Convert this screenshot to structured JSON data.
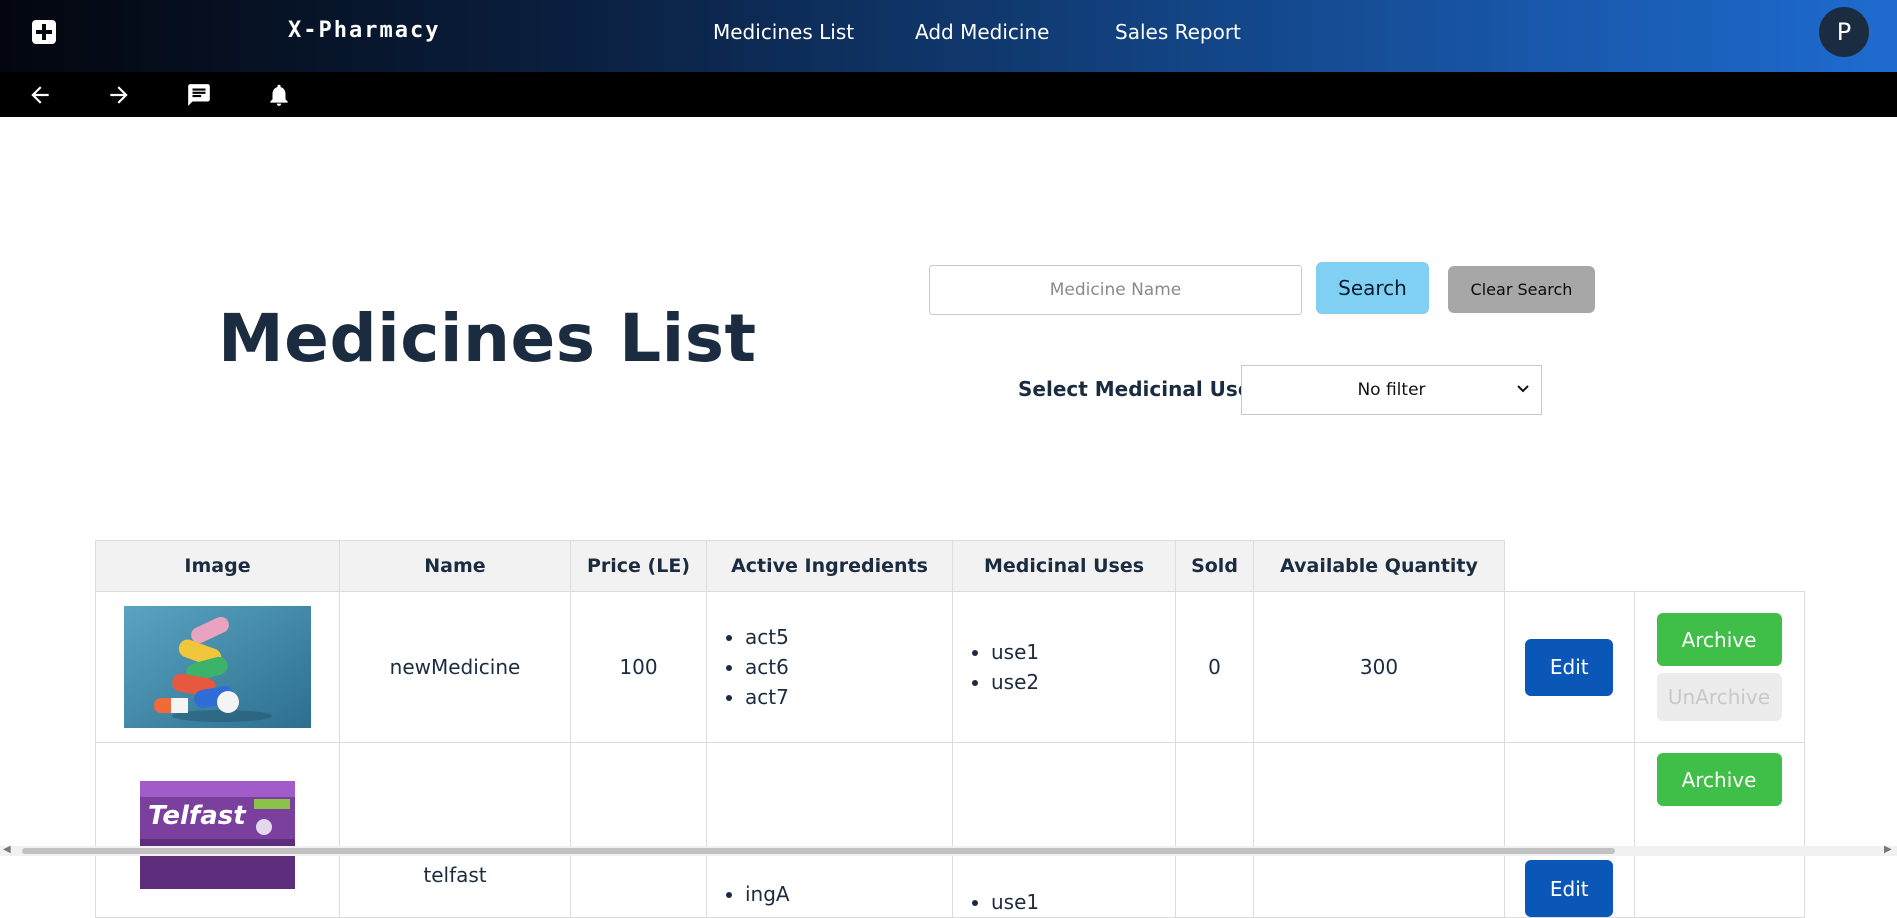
{
  "header": {
    "brand": "X-Pharmacy",
    "nav": [
      {
        "label": "Medicines List"
      },
      {
        "label": "Add Medicine"
      },
      {
        "label": "Sales Report"
      }
    ],
    "avatar_letter": "P",
    "logo_icon": "medical-cross-icon"
  },
  "subbar": {
    "icons": [
      "arrow-left-icon",
      "arrow-right-icon",
      "chat-icon",
      "bell-icon"
    ]
  },
  "main": {
    "title": "Medicines List",
    "search": {
      "placeholder": "Medicine Name",
      "value": "",
      "button": "Search",
      "clear_button": "Clear Search"
    },
    "filter": {
      "label": "Select Medicinal Use:",
      "selected": "No filter"
    }
  },
  "table": {
    "headers": [
      "Image",
      "Name",
      "Price (LE)",
      "Active Ingredients",
      "Medicinal Uses",
      "Sold",
      "Available Quantity"
    ],
    "rows": [
      {
        "image": "pills-image",
        "name": "newMedicine",
        "price": "100",
        "ingredients": [
          "act5",
          "act6",
          "act7"
        ],
        "uses": [
          "use1",
          "use2"
        ],
        "sold": "0",
        "available": "300",
        "edit_label": "Edit",
        "archive_label": "Archive",
        "unarchive_label": "UnArchive"
      },
      {
        "image": "telfast-box-image",
        "name": "telfast",
        "price": "",
        "ingredients": [
          "ingA"
        ],
        "uses": [
          "use1"
        ],
        "sold": "",
        "available": "",
        "edit_label": "Edit",
        "archive_label": "Archive"
      }
    ],
    "telfast_brand": "Telfast"
  },
  "colors": {
    "navbar_start": "#03060d",
    "navbar_end": "#1e6bd0",
    "search_button": "#7fd0f3",
    "edit_button": "#0b57b8",
    "archive_button": "#3fbf48",
    "title": "#1c2c40"
  }
}
